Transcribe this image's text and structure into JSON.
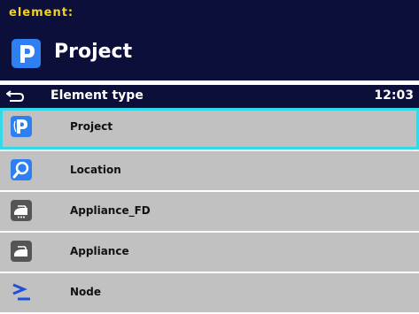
{
  "header": {
    "caption": "element:",
    "title": "Project",
    "icon": "project-p-icon"
  },
  "titlebar": {
    "label": "Element type",
    "time": "12:03",
    "back_icon": "back-arrow-icon"
  },
  "items": [
    {
      "label": "Project",
      "icon": "project-p-icon",
      "selected": true
    },
    {
      "label": "Location",
      "icon": "location-search-icon",
      "selected": false
    },
    {
      "label": "Appliance_FD",
      "icon": "iron-appliance-icon",
      "selected": false
    },
    {
      "label": "Appliance",
      "icon": "iron-appliance-icon",
      "selected": false
    },
    {
      "label": "Node",
      "icon": "node-symbol-icon",
      "selected": false
    }
  ],
  "colors": {
    "header_bg": "#0d0f3b",
    "caption": "#f2d31a",
    "icon_blue": "#2d7ff2",
    "selection_border": "#33d9e6",
    "row_bg": "#c1c1c1"
  }
}
